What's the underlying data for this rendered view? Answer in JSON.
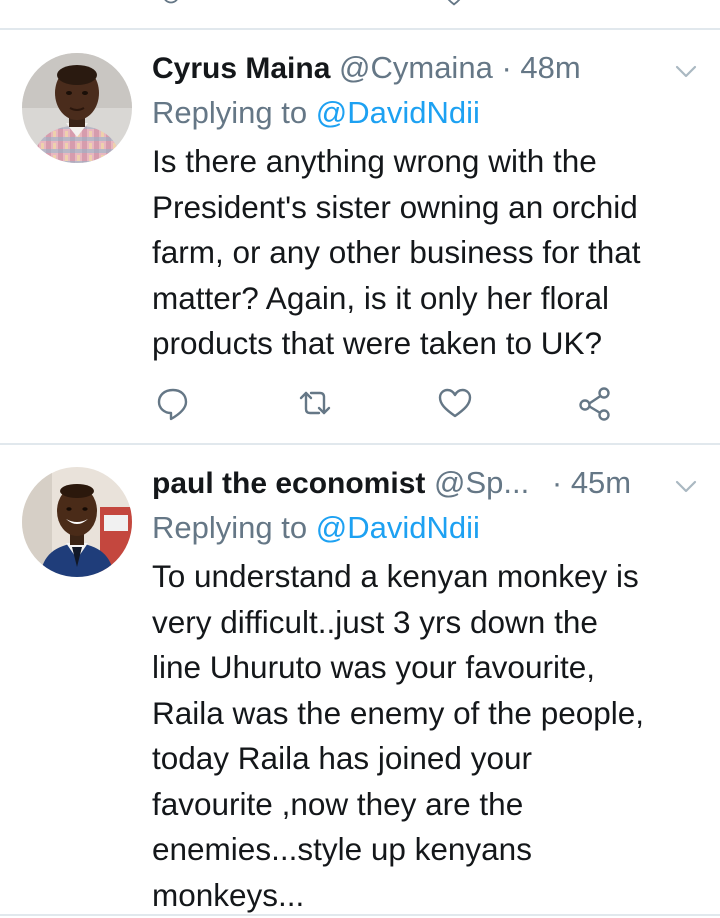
{
  "tweets": [
    {
      "name": "Cyrus Maina",
      "handle": "@Cymaina",
      "separator": "·",
      "time": "48m",
      "replying_prefix": "Replying to ",
      "replying_to": "@DavidNdii",
      "body_lines": [
        "Is there anything wrong with the",
        "President's  sister owning an orchid",
        "farm, or any other business for that",
        "matter? Again, is it only her floral",
        "products that were taken to UK?"
      ],
      "actions": [
        "reply-icon",
        "retweet-icon",
        "like-icon",
        "share-icon"
      ]
    },
    {
      "name": "paul the economist",
      "handle": "@Sp...",
      "separator": "·",
      "time": "45m",
      "replying_prefix": "Replying to ",
      "replying_to": "@DavidNdii",
      "body_lines": [
        "To understand a kenyan monkey is",
        "very difficult..just 3 yrs down the",
        "line Uhuruto was your favourite,",
        "Raila was the enemy of the people,",
        "today Raila has joined your",
        "favourite  ,now they are the",
        "enemies...style up kenyans",
        "monkeys..."
      ]
    }
  ],
  "colors": {
    "text_primary": "#14171a",
    "text_secondary": "#657786",
    "accent": "#1da1f2",
    "divider": "#e1e8ed"
  }
}
